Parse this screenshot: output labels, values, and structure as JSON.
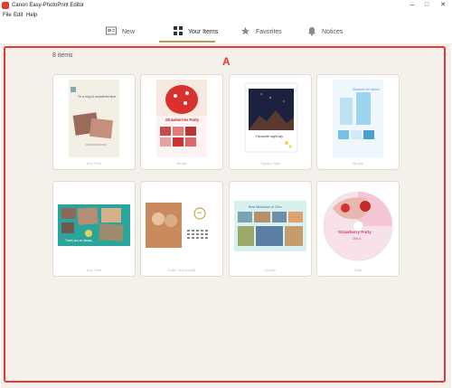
{
  "window": {
    "title": "Canon Easy-PhotoPrint Editor",
    "minimize": "–",
    "maximize": "□",
    "close": "✕"
  },
  "menu": [
    "File",
    "Edit",
    "Help"
  ],
  "tabs": [
    {
      "label": "New",
      "icon": "new-icon"
    },
    {
      "label": "Your Items",
      "icon": "grid-icon",
      "active": true
    },
    {
      "label": "Favorites",
      "icon": "star-icon"
    },
    {
      "label": "Notices",
      "icon": "bell-icon"
    }
  ],
  "annotation": {
    "letter": "A",
    "color": "#e53935"
  },
  "items_count": "8 items",
  "accent": "#c09a5a",
  "items": [
    {
      "caption": "Any Time",
      "texts": [
        "To a long & wonderful time"
      ]
    },
    {
      "caption": "Simple",
      "texts": [
        "Strawberries Party"
      ]
    },
    {
      "caption": "Square Size",
      "texts": [
        "Favourite night sky"
      ]
    },
    {
      "caption": "Simple",
      "texts": [
        "Summer ice drinks"
      ]
    },
    {
      "caption": "Any Time",
      "texts": [
        "Thank you so always"
      ]
    },
    {
      "caption": "Cute, One month",
      "texts": [
        "Luk"
      ]
    },
    {
      "caption": "Simple",
      "texts": [
        "Best Memories of 20xx"
      ]
    },
    {
      "caption": "Cute",
      "texts": [
        "Strawberry Party",
        "20xx.6"
      ]
    }
  ]
}
